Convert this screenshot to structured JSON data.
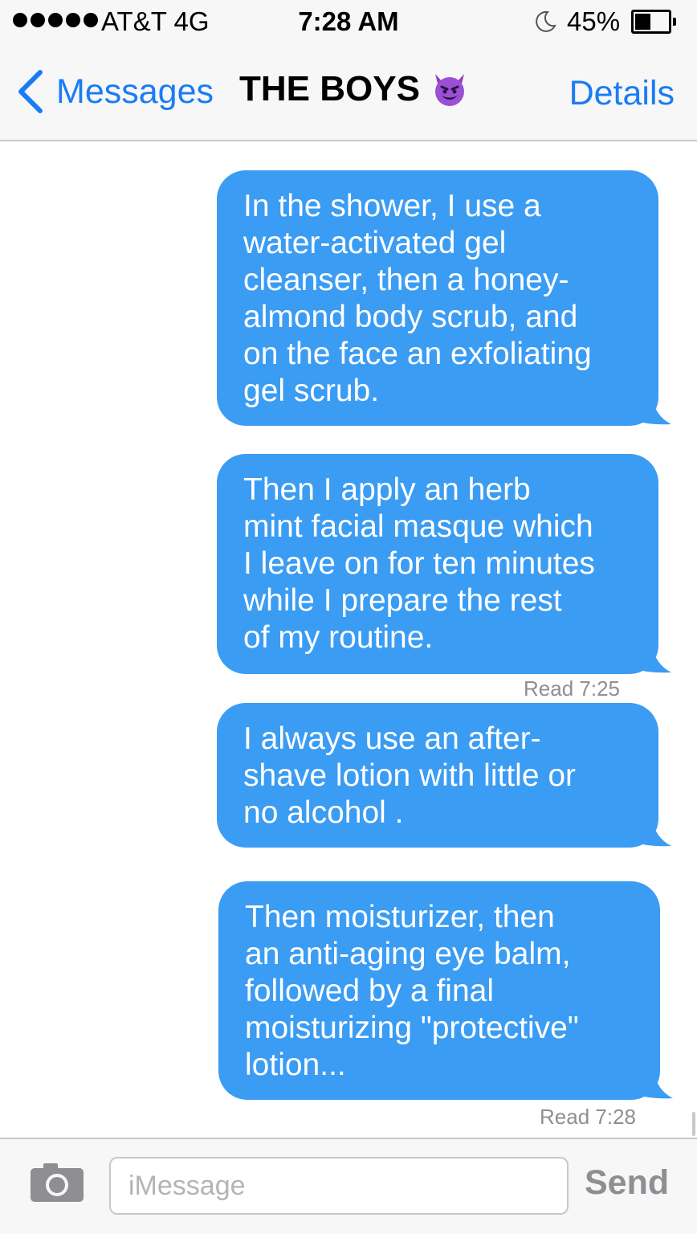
{
  "status_bar": {
    "carrier": "AT&T  4G",
    "time": "7:28 AM",
    "battery": "45%",
    "battery_level": 0.45,
    "signal_bars": 5,
    "moon_icon": "do-not-disturb-moon-icon"
  },
  "nav": {
    "back_label": "Messages",
    "title": "THE BOYS",
    "title_icon": "smiling-devil-emoji-icon",
    "details_label": "Details"
  },
  "colors": {
    "accent": "#1a7cf5",
    "bubble": "#3b9cf3",
    "receipt": "#8e8e93"
  },
  "messages": [
    {
      "text": "In the shower, I use a\nwater-activated gel\ncleanser, then a honey-\nalmond body scrub, and\non the face an exfoliating\ngel scrub."
    },
    {
      "text": "Then I apply an herb\nmint facial masque which\nI leave on for ten minutes\nwhile I prepare the rest\nof my routine.",
      "receipt": "Read 7:25"
    },
    {
      "text": "I always use an after-\nshave lotion with little or\nno alcohol ."
    },
    {
      "text": "Then moisturizer, then\nan anti-aging eye balm,\nfollowed by a final\nmoisturizing \"protective\"\nlotion...",
      "receipt": "Read 7:28"
    }
  ],
  "input": {
    "placeholder": "iMessage",
    "send_label": "Send",
    "camera_icon": "camera-icon"
  }
}
